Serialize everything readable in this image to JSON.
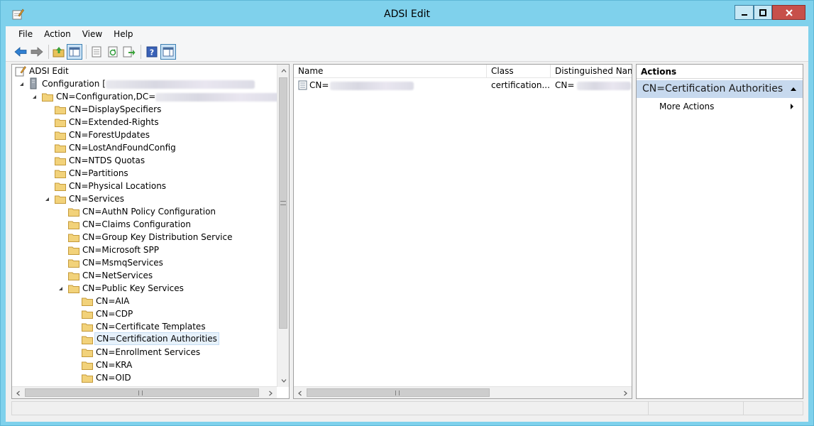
{
  "window": {
    "title": "ADSI Edit",
    "accent": "#7fd1ec",
    "close_color": "#c7504a"
  },
  "menu": [
    {
      "label": "File"
    },
    {
      "label": "Action"
    },
    {
      "label": "View"
    },
    {
      "label": "Help"
    }
  ],
  "toolbar": {
    "buttons": [
      "back-arrow-icon",
      "forward-arrow-icon",
      "up-folder-icon",
      "show-hide-tree-icon",
      "properties-icon",
      "refresh-icon",
      "export-list-icon",
      "help-icon",
      "show-hide-action-pane-icon"
    ]
  },
  "tree": {
    "root": "ADSI Edit",
    "configuration": "Configuration [",
    "cn_configuration": "CN=Configuration,DC=",
    "items": [
      {
        "label": "CN=DisplaySpecifiers"
      },
      {
        "label": "CN=Extended-Rights"
      },
      {
        "label": "CN=ForestUpdates"
      },
      {
        "label": "CN=LostAndFoundConfig"
      },
      {
        "label": "CN=NTDS Quotas"
      },
      {
        "label": "CN=Partitions"
      },
      {
        "label": "CN=Physical Locations"
      },
      {
        "label": "CN=Services"
      },
      {
        "label": "CN=AuthN Policy Configuration"
      },
      {
        "label": "CN=Claims Configuration"
      },
      {
        "label": "CN=Group Key Distribution Service"
      },
      {
        "label": "CN=Microsoft SPP"
      },
      {
        "label": "CN=MsmqServices"
      },
      {
        "label": "CN=NetServices"
      },
      {
        "label": "CN=Public Key Services"
      },
      {
        "label": "CN=AIA"
      },
      {
        "label": "CN=CDP"
      },
      {
        "label": "CN=Certificate Templates"
      },
      {
        "label": "CN=Certification Authorities"
      },
      {
        "label": "CN=Enrollment Services"
      },
      {
        "label": "CN=KRA"
      },
      {
        "label": "CN=OID"
      }
    ]
  },
  "list": {
    "columns": [
      "Name",
      "Class",
      "Distinguished Name"
    ],
    "rows": [
      {
        "name": "CN=",
        "class": "certification...",
        "dn": "CN="
      }
    ]
  },
  "actions": {
    "title": "Actions",
    "section": "CN=Certification Authorities",
    "item": "More Actions"
  }
}
